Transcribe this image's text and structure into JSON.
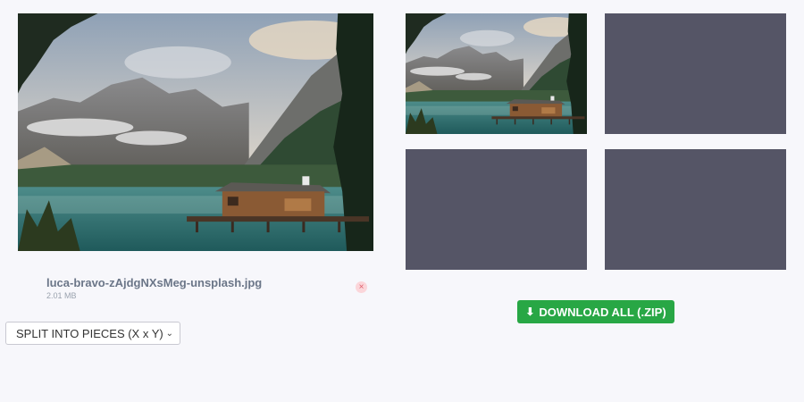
{
  "file": {
    "name": "luca-bravo-zAjdgNXsMeg-unsplash.jpg",
    "size": "2.01 MB",
    "remove_icon": "×"
  },
  "split_select": {
    "selected": "SPLIT INTO PIECES (X x Y)",
    "chevron_icon": "⌄"
  },
  "download": {
    "label": "DOWNLOAD ALL (.ZIP)",
    "icon": "⬇",
    "color": "#28a745"
  },
  "images": {
    "original_icon": "lake-mountain-photo",
    "pieces": [
      "top-left",
      "top-right",
      "bottom-left",
      "bottom-right"
    ]
  }
}
